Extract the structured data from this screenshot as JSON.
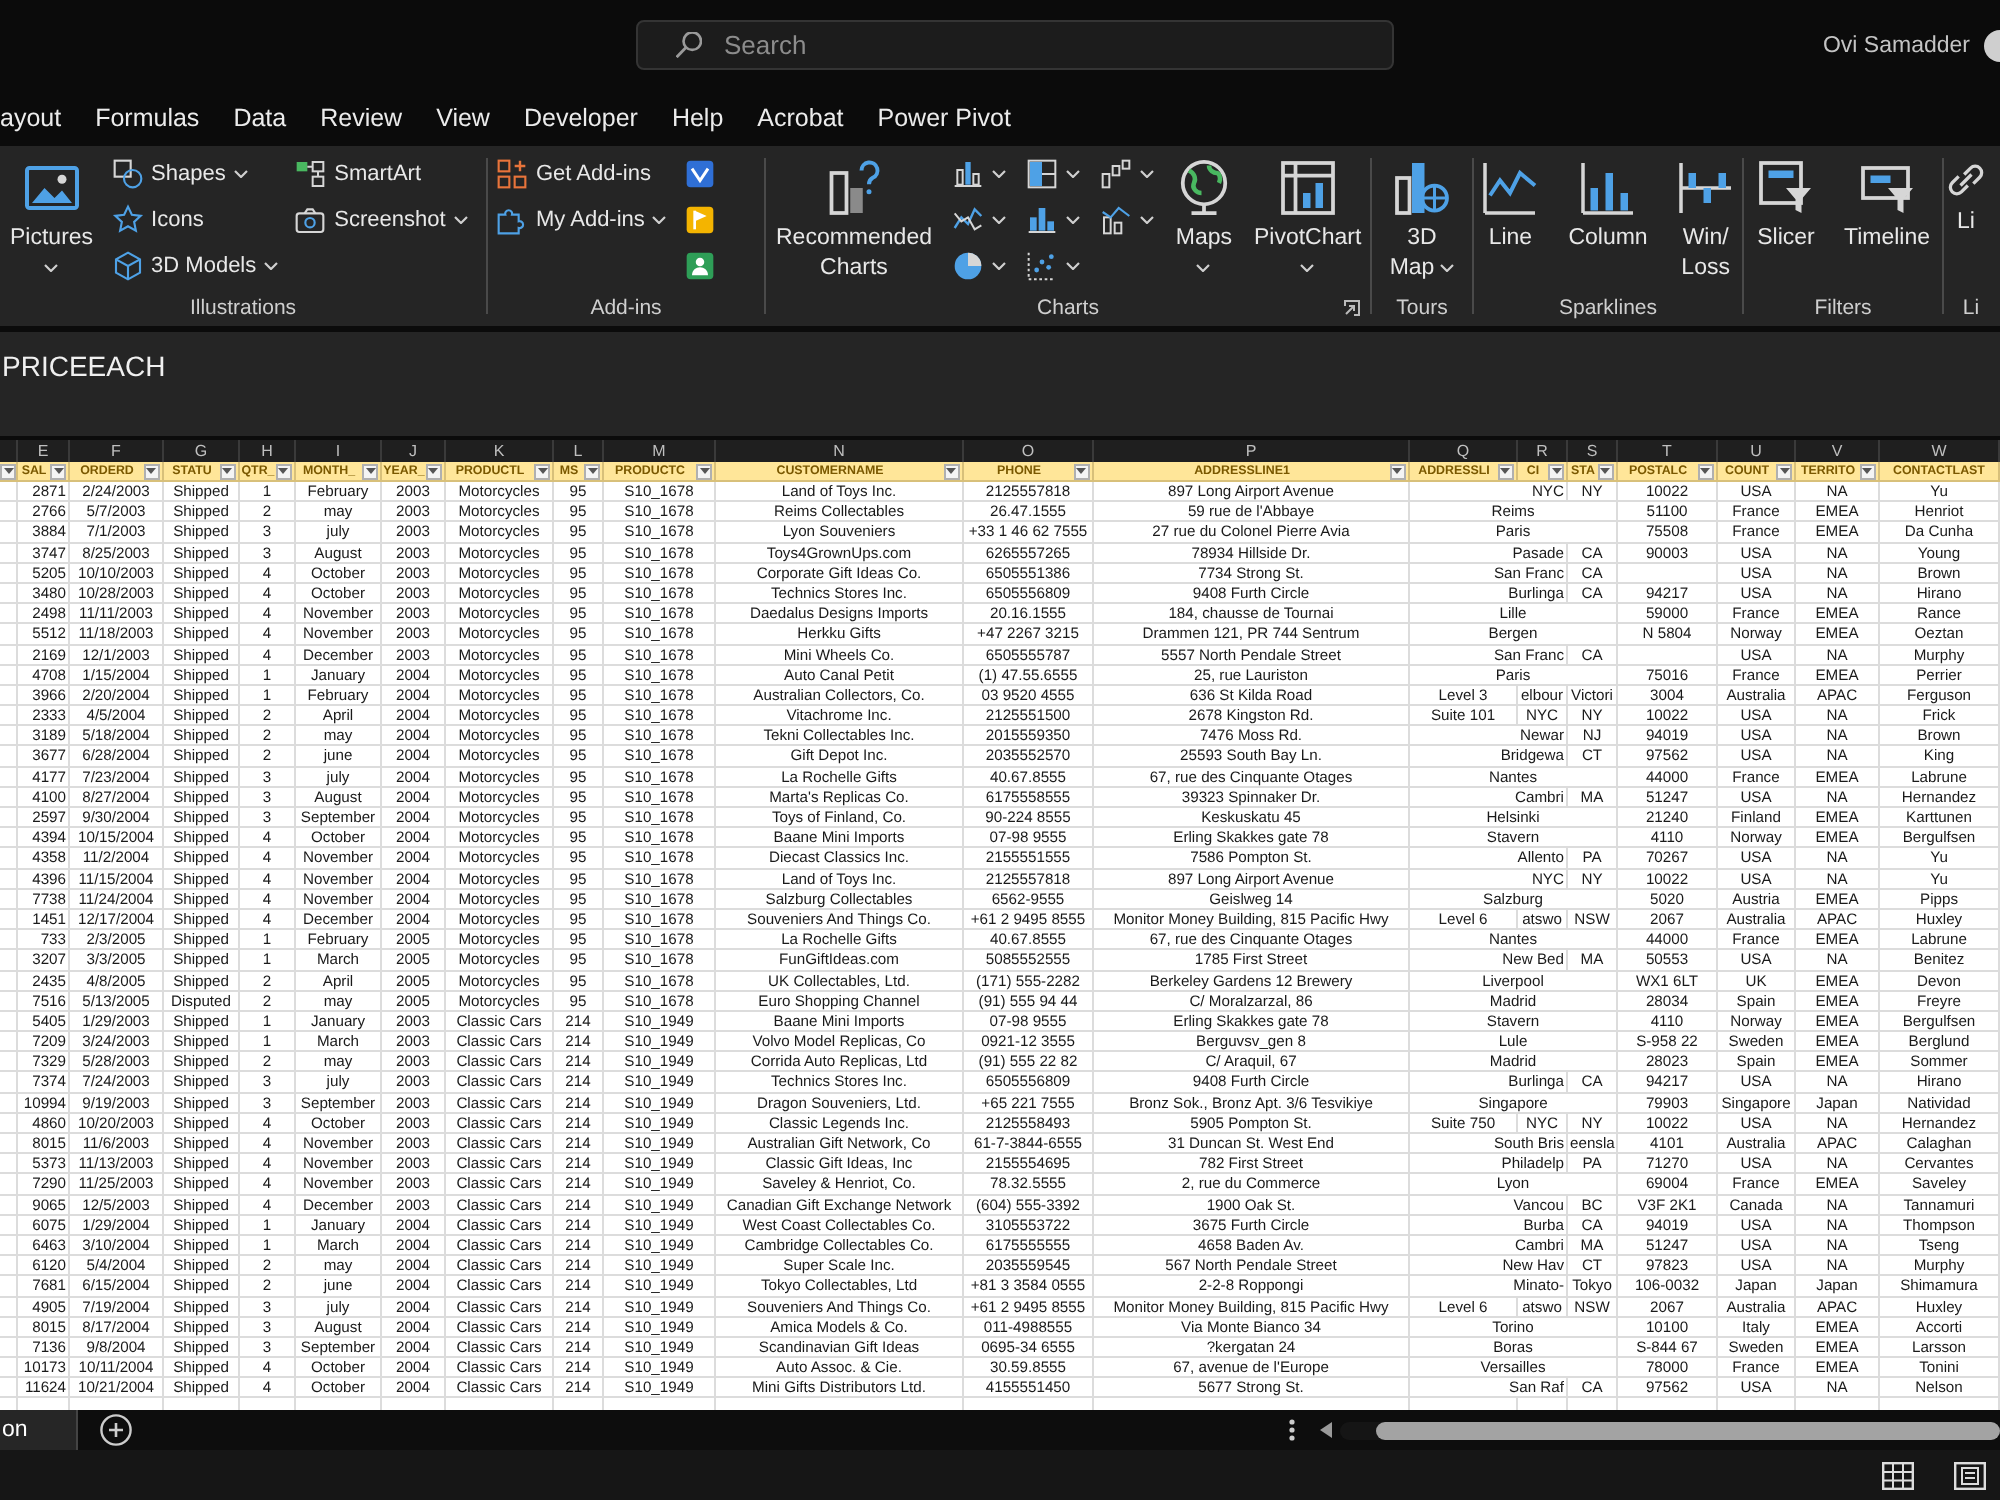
{
  "title_bar": {
    "search": {
      "placeholder": "Search"
    },
    "user_name": "Ovi Samadder"
  },
  "menu_tabs": [
    {
      "label": "ayout",
      "selected": false
    },
    {
      "label": "Formulas",
      "selected": false
    },
    {
      "label": "Data",
      "selected": false
    },
    {
      "label": "Review",
      "selected": false
    },
    {
      "label": "View",
      "selected": false
    },
    {
      "label": "Developer",
      "selected": false
    },
    {
      "label": "Help",
      "selected": false
    },
    {
      "label": "Acrobat",
      "selected": false
    },
    {
      "label": "Power Pivot",
      "selected": false
    }
  ],
  "ribbon": {
    "groups": [
      {
        "label": "Illustrations",
        "columns": [
          [
            {
              "kind": "large",
              "lines": [
                "Pictures"
              ],
              "dropdown": true
            }
          ],
          [
            {
              "kind": "small",
              "label": "Shapes",
              "dropdown": true
            },
            {
              "kind": "small",
              "label": "Icons"
            },
            {
              "kind": "small",
              "label": "3D Models",
              "dropdown": true
            }
          ],
          [
            {
              "kind": "small",
              "label": "SmartArt"
            },
            {
              "kind": "small",
              "label": "Screenshot",
              "dropdown": true
            }
          ]
        ]
      },
      {
        "label": "Add-ins",
        "columns": [
          [
            {
              "kind": "small",
              "label": "Get Add-ins"
            },
            {
              "kind": "small",
              "label": "My Add-ins",
              "dropdown": true
            }
          ],
          [
            {
              "kind": "icon"
            },
            {
              "kind": "icon"
            },
            {
              "kind": "icon"
            }
          ]
        ]
      },
      {
        "label": "Charts",
        "launcher": true,
        "columns": [
          [
            {
              "kind": "large",
              "lines": [
                "Recommended",
                "Charts"
              ]
            }
          ],
          [
            {
              "kind": "icon",
              "dropdown": true
            },
            {
              "kind": "icon",
              "dropdown": true
            },
            {
              "kind": "icon",
              "dropdown": true
            }
          ],
          [
            {
              "kind": "icon",
              "dropdown": true
            },
            {
              "kind": "icon",
              "dropdown": true
            },
            {
              "kind": "icon",
              "dropdown": true
            }
          ],
          [
            {
              "kind": "icon",
              "dropdown": true
            },
            {
              "kind": "icon",
              "dropdown": true
            }
          ],
          [
            {
              "kind": "large",
              "lines": [
                "Maps"
              ],
              "dropdown": true
            }
          ],
          [
            {
              "kind": "large",
              "lines": [
                "PivotChart"
              ],
              "dropdown": true
            }
          ]
        ]
      },
      {
        "label": "Tours",
        "columns": [
          [
            {
              "kind": "large",
              "lines": [
                "3D",
                "Map"
              ],
              "dropdown": true
            }
          ]
        ]
      },
      {
        "label": "Sparklines",
        "columns": [
          [
            {
              "kind": "large",
              "lines": [
                "Line"
              ]
            }
          ],
          [
            {
              "kind": "large",
              "lines": [
                "Column"
              ]
            }
          ],
          [
            {
              "kind": "large",
              "lines": [
                "Win/",
                "Loss"
              ]
            }
          ]
        ]
      },
      {
        "label": "Filters",
        "columns": [
          [
            {
              "kind": "large",
              "lines": [
                "Slicer"
              ]
            }
          ],
          [
            {
              "kind": "large",
              "lines": [
                "Timeline"
              ]
            }
          ]
        ]
      },
      {
        "label": "Li",
        "columns": [
          [
            {
              "kind": "large",
              "lines": [
                "Li"
              ]
            }
          ]
        ]
      }
    ]
  },
  "formula_bar": {
    "value": "PRICEEACH"
  },
  "table": {
    "columns": [
      {
        "filter": true
      },
      {
        "letter": "E",
        "header": "SAL",
        "filter": true
      },
      {
        "letter": "F",
        "header": "ORDERD",
        "filter": true
      },
      {
        "letter": "G",
        "header": "STATU",
        "filter": true
      },
      {
        "letter": "H",
        "header": "QTR_",
        "filter": true
      },
      {
        "letter": "I",
        "header": "MONTH_",
        "filter": true
      },
      {
        "letter": "J",
        "header": "YEAR_",
        "filter": true
      },
      {
        "letter": "K",
        "header": "PRODUCTL",
        "filter": true
      },
      {
        "letter": "L",
        "header": "MS",
        "filter": true
      },
      {
        "letter": "M",
        "header": "PRODUCTC",
        "filter": true
      },
      {
        "letter": "N",
        "header": "CUSTOMERNAME",
        "filter": true
      },
      {
        "letter": "O",
        "header": "PHONE",
        "filter": true
      },
      {
        "letter": "P",
        "header": "ADDRESSLINE1",
        "filter": true
      },
      {
        "letter": "Q",
        "header": "ADDRESSLI",
        "filter": true
      },
      {
        "letter": "R",
        "header": "CI",
        "filter": true
      },
      {
        "letter": "S",
        "header": "STA",
        "filter": true
      },
      {
        "letter": "T",
        "header": "POSTALC",
        "filter": true
      },
      {
        "letter": "U",
        "header": "COUNT",
        "filter": true
      },
      {
        "letter": "V",
        "header": "TERRITO",
        "filter": true
      },
      {
        "letter": "W",
        "header": "CONTACTLAST"
      }
    ],
    "rows": [
      {
        "e": "2871",
        "f": "2/24/2003",
        "g": "Shipped",
        "h": "1",
        "i": "February",
        "j": "2003",
        "k": "Motorcycles",
        "l": "95",
        "m": "S10_1678",
        "n": "Land of Toys Inc.",
        "o": "2125557818",
        "p": "897 Long Airport Avenue",
        "r": "NYC",
        "s": "NY",
        "t": "10022",
        "u": "USA",
        "v": "NA",
        "w": "Yu"
      },
      {
        "e": "2766",
        "f": "5/7/2003",
        "g": "Shipped",
        "h": "2",
        "i": "may",
        "j": "2003",
        "k": "Motorcycles",
        "l": "95",
        "m": "S10_1678",
        "n": "Reims Collectables",
        "o": "26.47.1555",
        "p": "59 rue de l'Abbaye",
        "r": "Reims",
        "t": "51100",
        "u": "France",
        "v": "EMEA",
        "w": "Henriot"
      },
      {
        "e": "3884",
        "f": "7/1/2003",
        "g": "Shipped",
        "h": "3",
        "i": "july",
        "j": "2003",
        "k": "Motorcycles",
        "l": "95",
        "m": "S10_1678",
        "n": "Lyon Souveniers",
        "o": "+33 1 46 62 7555",
        "p": "27 rue du Colonel Pierre Avia",
        "r": "Paris",
        "t": "75508",
        "u": "France",
        "v": "EMEA",
        "w": "Da Cunha"
      },
      {
        "e": "3747",
        "f": "8/25/2003",
        "g": "Shipped",
        "h": "3",
        "i": "August",
        "j": "2003",
        "k": "Motorcycles",
        "l": "95",
        "m": "S10_1678",
        "n": "Toys4GrownUps.com",
        "o": "6265557265",
        "p": "78934 Hillside Dr.",
        "r": "Pasade",
        "s": "CA",
        "t": "90003",
        "u": "USA",
        "v": "NA",
        "w": "Young"
      },
      {
        "e": "5205",
        "f": "10/10/2003",
        "g": "Shipped",
        "h": "4",
        "i": "October",
        "j": "2003",
        "k": "Motorcycles",
        "l": "95",
        "m": "S10_1678",
        "n": "Corporate Gift Ideas Co.",
        "o": "6505551386",
        "p": "7734 Strong St.",
        "r": "San Franc",
        "s": "CA",
        "u": "USA",
        "v": "NA",
        "w": "Brown"
      },
      {
        "e": "3480",
        "f": "10/28/2003",
        "g": "Shipped",
        "h": "4",
        "i": "October",
        "j": "2003",
        "k": "Motorcycles",
        "l": "95",
        "m": "S10_1678",
        "n": "Technics Stores Inc.",
        "o": "6505556809",
        "p": "9408 Furth Circle",
        "r": "Burlinga",
        "s": "CA",
        "t": "94217",
        "u": "USA",
        "v": "NA",
        "w": "Hirano"
      },
      {
        "e": "2498",
        "f": "11/11/2003",
        "g": "Shipped",
        "h": "4",
        "i": "November",
        "j": "2003",
        "k": "Motorcycles",
        "l": "95",
        "m": "S10_1678",
        "n": "Daedalus Designs Imports",
        "o": "20.16.1555",
        "p": "184, chausse de Tournai",
        "r": "Lille",
        "t": "59000",
        "u": "France",
        "v": "EMEA",
        "w": "Rance"
      },
      {
        "e": "5512",
        "f": "11/18/2003",
        "g": "Shipped",
        "h": "4",
        "i": "November",
        "j": "2003",
        "k": "Motorcycles",
        "l": "95",
        "m": "S10_1678",
        "n": "Herkku Gifts",
        "o": "+47 2267 3215",
        "p": "Drammen 121, PR 744 Sentrum",
        "r": "Bergen",
        "t": "N 5804",
        "u": "Norway",
        "v": "EMEA",
        "w": "Oeztan"
      },
      {
        "e": "2169",
        "f": "12/1/2003",
        "g": "Shipped",
        "h": "4",
        "i": "December",
        "j": "2003",
        "k": "Motorcycles",
        "l": "95",
        "m": "S10_1678",
        "n": "Mini Wheels Co.",
        "o": "6505555787",
        "p": "5557 North Pendale Street",
        "r": "San Franc",
        "s": "CA",
        "u": "USA",
        "v": "NA",
        "w": "Murphy"
      },
      {
        "e": "4708",
        "f": "1/15/2004",
        "g": "Shipped",
        "h": "1",
        "i": "January",
        "j": "2004",
        "k": "Motorcycles",
        "l": "95",
        "m": "S10_1678",
        "n": "Auto Canal Petit",
        "o": "(1) 47.55.6555",
        "p": "25, rue Lauriston",
        "r": "Paris",
        "t": "75016",
        "u": "France",
        "v": "EMEA",
        "w": "Perrier"
      },
      {
        "e": "3966",
        "f": "2/20/2004",
        "g": "Shipped",
        "h": "1",
        "i": "February",
        "j": "2004",
        "k": "Motorcycles",
        "l": "95",
        "m": "S10_1678",
        "n": "Australian Collectors, Co.",
        "o": "03 9520 4555",
        "p": "636 St Kilda Road",
        "q": "Level 3",
        "r": "elbour",
        "s": "Victori",
        "t": "3004",
        "u": "Australia",
        "v": "APAC",
        "w": "Ferguson"
      },
      {
        "e": "2333",
        "f": "4/5/2004",
        "g": "Shipped",
        "h": "2",
        "i": "April",
        "j": "2004",
        "k": "Motorcycles",
        "l": "95",
        "m": "S10_1678",
        "n": "Vitachrome Inc.",
        "o": "2125551500",
        "p": "2678 Kingston Rd.",
        "q": "Suite 101",
        "r": "NYC",
        "s": "NY",
        "t": "10022",
        "u": "USA",
        "v": "NA",
        "w": "Frick"
      },
      {
        "e": "3189",
        "f": "5/18/2004",
        "g": "Shipped",
        "h": "2",
        "i": "may",
        "j": "2004",
        "k": "Motorcycles",
        "l": "95",
        "m": "S10_1678",
        "n": "Tekni Collectables Inc.",
        "o": "2015559350",
        "p": "7476 Moss Rd.",
        "r": "Newar",
        "s": "NJ",
        "t": "94019",
        "u": "USA",
        "v": "NA",
        "w": "Brown"
      },
      {
        "e": "3677",
        "f": "6/28/2004",
        "g": "Shipped",
        "h": "2",
        "i": "june",
        "j": "2004",
        "k": "Motorcycles",
        "l": "95",
        "m": "S10_1678",
        "n": "Gift Depot Inc.",
        "o": "2035552570",
        "p": "25593 South Bay Ln.",
        "r": "Bridgewa",
        "s": "CT",
        "t": "97562",
        "u": "USA",
        "v": "NA",
        "w": "King"
      },
      {
        "e": "4177",
        "f": "7/23/2004",
        "g": "Shipped",
        "h": "3",
        "i": "july",
        "j": "2004",
        "k": "Motorcycles",
        "l": "95",
        "m": "S10_1678",
        "n": "La Rochelle Gifts",
        "o": "40.67.8555",
        "p": "67, rue des Cinquante Otages",
        "r": "Nantes",
        "t": "44000",
        "u": "France",
        "v": "EMEA",
        "w": "Labrune"
      },
      {
        "e": "4100",
        "f": "8/27/2004",
        "g": "Shipped",
        "h": "3",
        "i": "August",
        "j": "2004",
        "k": "Motorcycles",
        "l": "95",
        "m": "S10_1678",
        "n": "Marta's Replicas Co.",
        "o": "6175558555",
        "p": "39323 Spinnaker Dr.",
        "r": "Cambri",
        "s": "MA",
        "t": "51247",
        "u": "USA",
        "v": "NA",
        "w": "Hernandez"
      },
      {
        "e": "2597",
        "f": "9/30/2004",
        "g": "Shipped",
        "h": "3",
        "i": "September",
        "j": "2004",
        "k": "Motorcycles",
        "l": "95",
        "m": "S10_1678",
        "n": "Toys of Finland, Co.",
        "o": "90-224 8555",
        "p": "Keskuskatu 45",
        "r": "Helsinki",
        "t": "21240",
        "u": "Finland",
        "v": "EMEA",
        "w": "Karttunen"
      },
      {
        "e": "4394",
        "f": "10/15/2004",
        "g": "Shipped",
        "h": "4",
        "i": "October",
        "j": "2004",
        "k": "Motorcycles",
        "l": "95",
        "m": "S10_1678",
        "n": "Baane Mini Imports",
        "o": "07-98 9555",
        "p": "Erling Skakkes gate 78",
        "r": "Stavern",
        "t": "4110",
        "u": "Norway",
        "v": "EMEA",
        "w": "Bergulfsen"
      },
      {
        "e": "4358",
        "f": "11/2/2004",
        "g": "Shipped",
        "h": "4",
        "i": "November",
        "j": "2004",
        "k": "Motorcycles",
        "l": "95",
        "m": "S10_1678",
        "n": "Diecast Classics Inc.",
        "o": "2155551555",
        "p": "7586 Pompton St.",
        "r": "Allento",
        "s": "PA",
        "t": "70267",
        "u": "USA",
        "v": "NA",
        "w": "Yu"
      },
      {
        "e": "4396",
        "f": "11/15/2004",
        "g": "Shipped",
        "h": "4",
        "i": "November",
        "j": "2004",
        "k": "Motorcycles",
        "l": "95",
        "m": "S10_1678",
        "n": "Land of Toys Inc.",
        "o": "2125557818",
        "p": "897 Long Airport Avenue",
        "r": "NYC",
        "s": "NY",
        "t": "10022",
        "u": "USA",
        "v": "NA",
        "w": "Yu"
      },
      {
        "e": "7738",
        "f": "11/24/2004",
        "g": "Shipped",
        "h": "4",
        "i": "November",
        "j": "2004",
        "k": "Motorcycles",
        "l": "95",
        "m": "S10_1678",
        "n": "Salzburg Collectables",
        "o": "6562-9555",
        "p": "Geislweg 14",
        "r": "Salzburg",
        "t": "5020",
        "u": "Austria",
        "v": "EMEA",
        "w": "Pipps"
      },
      {
        "e": "1451",
        "f": "12/17/2004",
        "g": "Shipped",
        "h": "4",
        "i": "December",
        "j": "2004",
        "k": "Motorcycles",
        "l": "95",
        "m": "S10_1678",
        "n": "Souveniers And Things Co.",
        "o": "+61 2 9495 8555",
        "p": "Monitor Money Building, 815 Pacific Hwy",
        "q": "Level 6",
        "r": "atswo",
        "s": "NSW",
        "t": "2067",
        "u": "Australia",
        "v": "APAC",
        "w": "Huxley"
      },
      {
        "e": "733",
        "f": "2/3/2005",
        "g": "Shipped",
        "h": "1",
        "i": "February",
        "j": "2005",
        "k": "Motorcycles",
        "l": "95",
        "m": "S10_1678",
        "n": "La Rochelle Gifts",
        "o": "40.67.8555",
        "p": "67, rue des Cinquante Otages",
        "r": "Nantes",
        "t": "44000",
        "u": "France",
        "v": "EMEA",
        "w": "Labrune"
      },
      {
        "e": "3207",
        "f": "3/3/2005",
        "g": "Shipped",
        "h": "1",
        "i": "March",
        "j": "2005",
        "k": "Motorcycles",
        "l": "95",
        "m": "S10_1678",
        "n": "FunGiftIdeas.com",
        "o": "5085552555",
        "p": "1785 First Street",
        "r": "New Bed",
        "s": "MA",
        "t": "50553",
        "u": "USA",
        "v": "NA",
        "w": "Benitez"
      },
      {
        "e": "2435",
        "f": "4/8/2005",
        "g": "Shipped",
        "h": "2",
        "i": "April",
        "j": "2005",
        "k": "Motorcycles",
        "l": "95",
        "m": "S10_1678",
        "n": "UK Collectables, Ltd.",
        "o": "(171) 555-2282",
        "p": "Berkeley Gardens 12 Brewery",
        "r": "Liverpool",
        "t": "WX1 6LT",
        "u": "UK",
        "v": "EMEA",
        "w": "Devon"
      },
      {
        "e": "7516",
        "f": "5/13/2005",
        "g": "Disputed",
        "h": "2",
        "i": "may",
        "j": "2005",
        "k": "Motorcycles",
        "l": "95",
        "m": "S10_1678",
        "n": "Euro Shopping Channel",
        "o": "(91) 555 94 44",
        "p": "C/ Moralzarzal, 86",
        "r": "Madrid",
        "t": "28034",
        "u": "Spain",
        "v": "EMEA",
        "w": "Freyre"
      },
      {
        "e": "5405",
        "f": "1/29/2003",
        "g": "Shipped",
        "h": "1",
        "i": "January",
        "j": "2003",
        "k": "Classic Cars",
        "l": "214",
        "m": "S10_1949",
        "n": "Baane Mini Imports",
        "o": "07-98 9555",
        "p": "Erling Skakkes gate 78",
        "r": "Stavern",
        "t": "4110",
        "u": "Norway",
        "v": "EMEA",
        "w": "Bergulfsen"
      },
      {
        "e": "7209",
        "f": "3/24/2003",
        "g": "Shipped",
        "h": "1",
        "i": "March",
        "j": "2003",
        "k": "Classic Cars",
        "l": "214",
        "m": "S10_1949",
        "n": "Volvo Model Replicas, Co",
        "o": "0921-12 3555",
        "p": "Berguvsv_gen 8",
        "r": "Lule",
        "t": "S-958 22",
        "u": "Sweden",
        "v": "EMEA",
        "w": "Berglund"
      },
      {
        "e": "7329",
        "f": "5/28/2003",
        "g": "Shipped",
        "h": "2",
        "i": "may",
        "j": "2003",
        "k": "Classic Cars",
        "l": "214",
        "m": "S10_1949",
        "n": "Corrida Auto Replicas, Ltd",
        "o": "(91) 555 22 82",
        "p": "C/ Araquil, 67",
        "r": "Madrid",
        "t": "28023",
        "u": "Spain",
        "v": "EMEA",
        "w": "Sommer"
      },
      {
        "e": "7374",
        "f": "7/24/2003",
        "g": "Shipped",
        "h": "3",
        "i": "july",
        "j": "2003",
        "k": "Classic Cars",
        "l": "214",
        "m": "S10_1949",
        "n": "Technics Stores Inc.",
        "o": "6505556809",
        "p": "9408 Furth Circle",
        "r": "Burlinga",
        "s": "CA",
        "t": "94217",
        "u": "USA",
        "v": "NA",
        "w": "Hirano"
      },
      {
        "e": "10994",
        "f": "9/19/2003",
        "g": "Shipped",
        "h": "3",
        "i": "September",
        "j": "2003",
        "k": "Classic Cars",
        "l": "214",
        "m": "S10_1949",
        "n": "Dragon Souveniers, Ltd.",
        "o": "+65 221 7555",
        "p": "Bronz Sok., Bronz Apt. 3/6 Tesvikiye",
        "r": "Singapore",
        "t": "79903",
        "u": "Singapore",
        "v": "Japan",
        "w": "Natividad"
      },
      {
        "e": "4860",
        "f": "10/20/2003",
        "g": "Shipped",
        "h": "4",
        "i": "October",
        "j": "2003",
        "k": "Classic Cars",
        "l": "214",
        "m": "S10_1949",
        "n": "Classic Legends Inc.",
        "o": "2125558493",
        "p": "5905 Pompton St.",
        "q": "Suite 750",
        "r": "NYC",
        "s": "NY",
        "t": "10022",
        "u": "USA",
        "v": "NA",
        "w": "Hernandez"
      },
      {
        "e": "8015",
        "f": "11/6/2003",
        "g": "Shipped",
        "h": "4",
        "i": "November",
        "j": "2003",
        "k": "Classic Cars",
        "l": "214",
        "m": "S10_1949",
        "n": "Australian Gift Network, Co",
        "o": "61-7-3844-6555",
        "p": "31 Duncan St. West End",
        "r": "South Bris",
        "s": "eensla",
        "t": "4101",
        "u": "Australia",
        "v": "APAC",
        "w": "Calaghan"
      },
      {
        "e": "5373",
        "f": "11/13/2003",
        "g": "Shipped",
        "h": "4",
        "i": "November",
        "j": "2003",
        "k": "Classic Cars",
        "l": "214",
        "m": "S10_1949",
        "n": "Classic Gift Ideas, Inc",
        "o": "2155554695",
        "p": "782 First Street",
        "r": "Philadelp",
        "s": "PA",
        "t": "71270",
        "u": "USA",
        "v": "NA",
        "w": "Cervantes"
      },
      {
        "e": "7290",
        "f": "11/25/2003",
        "g": "Shipped",
        "h": "4",
        "i": "November",
        "j": "2003",
        "k": "Classic Cars",
        "l": "214",
        "m": "S10_1949",
        "n": "Saveley & Henriot, Co.",
        "o": "78.32.5555",
        "p": "2, rue du Commerce",
        "r": "Lyon",
        "t": "69004",
        "u": "France",
        "v": "EMEA",
        "w": "Saveley"
      },
      {
        "e": "9065",
        "f": "12/5/2003",
        "g": "Shipped",
        "h": "4",
        "i": "December",
        "j": "2003",
        "k": "Classic Cars",
        "l": "214",
        "m": "S10_1949",
        "n": "Canadian Gift Exchange Network",
        "o": "(604) 555-3392",
        "p": "1900 Oak St.",
        "r": "Vancou",
        "s": "BC",
        "t": "V3F 2K1",
        "u": "Canada",
        "v": "NA",
        "w": "Tannamuri"
      },
      {
        "e": "6075",
        "f": "1/29/2004",
        "g": "Shipped",
        "h": "1",
        "i": "January",
        "j": "2004",
        "k": "Classic Cars",
        "l": "214",
        "m": "S10_1949",
        "n": "West Coast Collectables Co.",
        "o": "3105553722",
        "p": "3675 Furth Circle",
        "r": "Burba",
        "s": "CA",
        "t": "94019",
        "u": "USA",
        "v": "NA",
        "w": "Thompson"
      },
      {
        "e": "6463",
        "f": "3/10/2004",
        "g": "Shipped",
        "h": "1",
        "i": "March",
        "j": "2004",
        "k": "Classic Cars",
        "l": "214",
        "m": "S10_1949",
        "n": "Cambridge Collectables Co.",
        "o": "6175555555",
        "p": "4658 Baden Av.",
        "r": "Cambri",
        "s": "MA",
        "t": "51247",
        "u": "USA",
        "v": "NA",
        "w": "Tseng"
      },
      {
        "e": "6120",
        "f": "5/4/2004",
        "g": "Shipped",
        "h": "2",
        "i": "may",
        "j": "2004",
        "k": "Classic Cars",
        "l": "214",
        "m": "S10_1949",
        "n": "Super Scale Inc.",
        "o": "2035559545",
        "p": "567 North Pendale Street",
        "r": "New Hav",
        "s": "CT",
        "t": "97823",
        "u": "USA",
        "v": "NA",
        "w": "Murphy"
      },
      {
        "e": "7681",
        "f": "6/15/2004",
        "g": "Shipped",
        "h": "2",
        "i": "june",
        "j": "2004",
        "k": "Classic Cars",
        "l": "214",
        "m": "S10_1949",
        "n": "Tokyo Collectables, Ltd",
        "o": "+81 3 3584 0555",
        "p": "2-2-8 Roppongi",
        "r": "Minato-",
        "s": "Tokyo",
        "t": "106-0032",
        "u": "Japan",
        "v": "Japan",
        "w": "Shimamura"
      },
      {
        "e": "4905",
        "f": "7/19/2004",
        "g": "Shipped",
        "h": "3",
        "i": "july",
        "j": "2004",
        "k": "Classic Cars",
        "l": "214",
        "m": "S10_1949",
        "n": "Souveniers And Things Co.",
        "o": "+61 2 9495 8555",
        "p": "Monitor Money Building, 815 Pacific Hwy",
        "q": "Level 6",
        "r": "atswo",
        "s": "NSW",
        "t": "2067",
        "u": "Australia",
        "v": "APAC",
        "w": "Huxley"
      },
      {
        "e": "8015",
        "f": "8/17/2004",
        "g": "Shipped",
        "h": "3",
        "i": "August",
        "j": "2004",
        "k": "Classic Cars",
        "l": "214",
        "m": "S10_1949",
        "n": "Amica Models & Co.",
        "o": "011-4988555",
        "p": "Via Monte Bianco 34",
        "r": "Torino",
        "t": "10100",
        "u": "Italy",
        "v": "EMEA",
        "w": "Accorti"
      },
      {
        "e": "7136",
        "f": "9/8/2004",
        "g": "Shipped",
        "h": "3",
        "i": "September",
        "j": "2004",
        "k": "Classic Cars",
        "l": "214",
        "m": "S10_1949",
        "n": "Scandinavian Gift Ideas",
        "o": "0695-34 6555",
        "p": "?kergatan 24",
        "r": "Boras",
        "t": "S-844 67",
        "u": "Sweden",
        "v": "EMEA",
        "w": "Larsson"
      },
      {
        "e": "10173",
        "f": "10/11/2004",
        "g": "Shipped",
        "h": "4",
        "i": "October",
        "j": "2004",
        "k": "Classic Cars",
        "l": "214",
        "m": "S10_1949",
        "n": "Auto Assoc. & Cie.",
        "o": "30.59.8555",
        "p": "67, avenue de l'Europe",
        "r": "Versailles",
        "t": "78000",
        "u": "France",
        "v": "EMEA",
        "w": "Tonini"
      },
      {
        "e": "11624",
        "f": "10/21/2004",
        "g": "Shipped",
        "h": "4",
        "i": "October",
        "j": "2004",
        "k": "Classic Cars",
        "l": "214",
        "m": "S10_1949",
        "n": "Mini Gifts Distributors Ltd.",
        "o": "4155551450",
        "p": "5677 Strong St.",
        "r": "San Raf",
        "s": "CA",
        "t": "97562",
        "u": "USA",
        "v": "NA",
        "w": "Nelson"
      }
    ]
  },
  "sheet_tabs": [
    {
      "label": "on",
      "selected": true
    }
  ]
}
